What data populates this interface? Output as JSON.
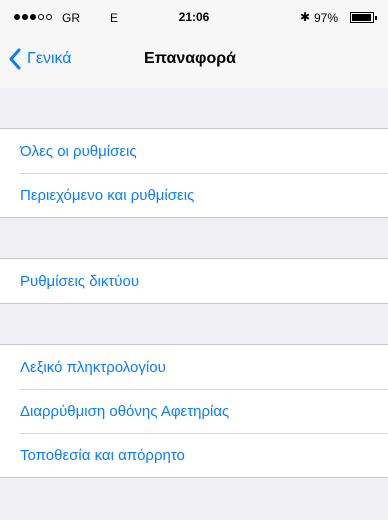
{
  "status_bar": {
    "carrier": "GR",
    "network": "E",
    "time": "21:06",
    "battery_percent": "97%",
    "battery_level": 0.97,
    "signal_bars_filled": 3,
    "signal_bars_total": 5
  },
  "nav": {
    "back_label": "Γενικά",
    "title": "Επαναφορά"
  },
  "groups": [
    {
      "items": [
        {
          "label": "Όλες οι ρυθμίσεις"
        },
        {
          "label": "Περιεχόμενο και ρυθμίσεις"
        }
      ]
    },
    {
      "items": [
        {
          "label": "Ρυθμίσεις δικτύου"
        }
      ]
    },
    {
      "items": [
        {
          "label": "Λεξικό πληκτρολογίου"
        },
        {
          "label": "Διαρρύθμιση οθόνης Αφετηρίας"
        },
        {
          "label": "Τοποθεσία και απόρρητο"
        }
      ]
    }
  ],
  "colors": {
    "accent": "#0a7cff",
    "background": "#efeff4",
    "separator": "#c8c7cc"
  }
}
